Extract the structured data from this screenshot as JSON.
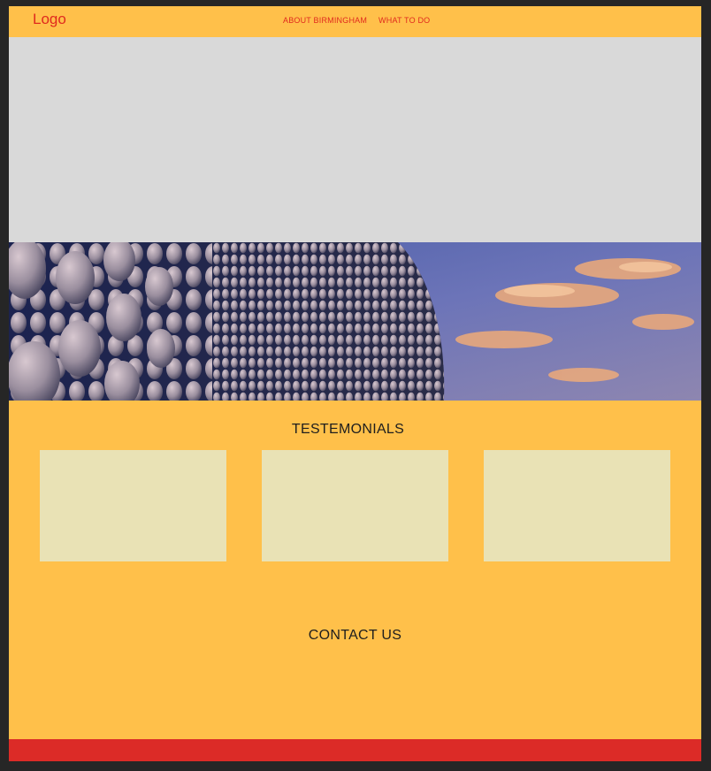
{
  "header": {
    "logo": "Logo",
    "nav": [
      {
        "label": "ABOUT BIRMINGHAM"
      },
      {
        "label": "WHAT TO DO"
      }
    ]
  },
  "testimonials": {
    "title": "TESTEMONIALS",
    "cards": [
      {},
      {},
      {}
    ]
  },
  "contact": {
    "title": "CONTACT US"
  },
  "colors": {
    "background": "#FFC04A",
    "accent": "#E02A1E",
    "card": "#E9E2B5",
    "hero_placeholder": "#D9D9D9",
    "footer": "#DC2B27"
  }
}
